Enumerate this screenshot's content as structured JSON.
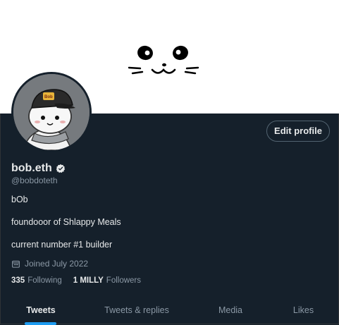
{
  "profile": {
    "display_name": "bob.eth",
    "handle": "@bobdoteth",
    "edit_button_label": "Edit profile",
    "avatar_cap_text": "Bob",
    "bio": [
      "bOb",
      "foundooor of Shlappy Meals",
      "current number #1 builder"
    ],
    "joined": "Joined July 2022",
    "following_count": "335",
    "following_label": "Following",
    "followers_count": "1 MILLY",
    "followers_label": "Followers"
  },
  "tabs": [
    {
      "label": "Tweets",
      "active": true
    },
    {
      "label": "Tweets & replies",
      "active": false
    },
    {
      "label": "Media",
      "active": false
    },
    {
      "label": "Likes",
      "active": false
    }
  ],
  "colors": {
    "background": "#15202b",
    "accent": "#1d9bf0",
    "text_primary": "#e7e9ea",
    "text_secondary": "#8b98a5"
  },
  "icons": {
    "verified": "verified-badge-icon",
    "joined": "calendar-icon"
  }
}
